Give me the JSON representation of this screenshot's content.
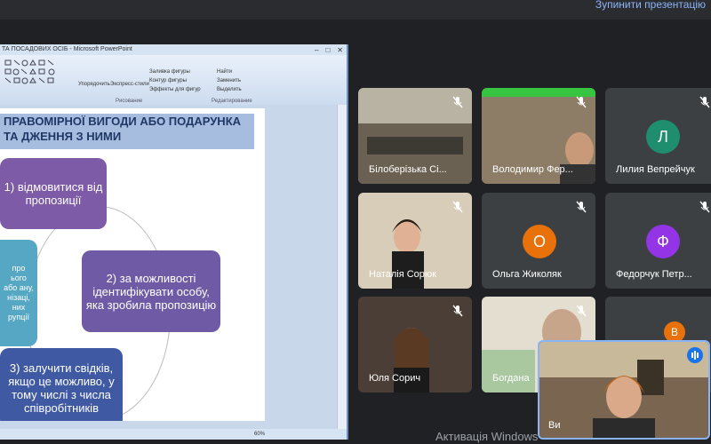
{
  "meet": {
    "stop_presenting": "Зупинити презентацію",
    "activate_windows": "Активація Windows"
  },
  "ppt": {
    "window_title": "ТА ПОСАДОВИХ ОСІБ - Microsoft PowerPoint",
    "ribbon": {
      "paste": "Упорядочить",
      "quick_styles": "Экспресс-стили",
      "shape_fill": "Заливка фигуры",
      "shape_outline": "Контур фигуры",
      "shape_effects": "Эффекты для фигур",
      "find": "Найти",
      "replace": "Заменить",
      "select": "Выделить",
      "group_drawing": "Рисование",
      "group_editing": "Редактирование"
    },
    "slide": {
      "title": "ПРАВОМІРНОЇ ВИГОДИ АБО ПОДАРУНКА ТА ДЖЕННЯ З НИМИ",
      "box1": "1) відмовитися від пропозиції",
      "box2": "2) за можливості ідентифікувати особу, яка зробила пропозицію",
      "box3": "3) залучити свідків, якщо це можливо, у тому числі з числа співробітників",
      "box4": "про ього або ану, нізаці, них рупції"
    },
    "zoom": "60%"
  },
  "participants": [
    {
      "name": "Білоберізька Сі...",
      "type": "video",
      "muted": true
    },
    {
      "name": "Володимир Фер...",
      "type": "video",
      "muted": true
    },
    {
      "name": "Лилия Вепрейчук",
      "type": "avatar",
      "initial": "Л",
      "color": "#1e8e6e",
      "muted": true
    },
    {
      "name": "Наталія Сорюк",
      "type": "video",
      "muted": true
    },
    {
      "name": "Ольга Жиколяк",
      "type": "avatar",
      "initial": "О",
      "color": "#e8710a",
      "muted": true
    },
    {
      "name": "Федорчук Петр...",
      "type": "avatar",
      "initial": "Ф",
      "color": "#9334e6",
      "muted": true
    },
    {
      "name": "Юля Сорич",
      "type": "video",
      "muted": true
    },
    {
      "name": "Богдана",
      "type": "video",
      "muted": true
    },
    {
      "name": "",
      "type": "group",
      "initial": "В",
      "color": "#e8710a",
      "muted": false
    }
  ],
  "self": {
    "name": "Ви"
  }
}
